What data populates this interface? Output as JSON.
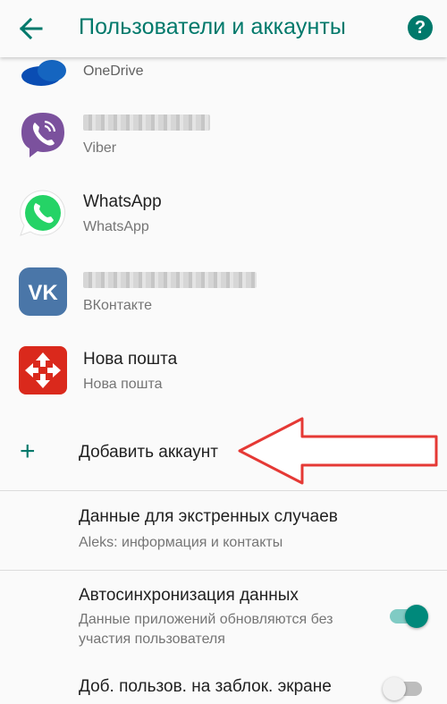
{
  "header": {
    "title": "Пользователи и аккаунты",
    "back_icon": "arrow-left-icon",
    "help_icon": "help-circle-icon",
    "help_glyph": "?"
  },
  "accounts": [
    {
      "name": "OneDrive",
      "sub": "OneDrive",
      "icon": "onedrive-icon",
      "color": "#0a4db3"
    },
    {
      "name": "",
      "sub": "Viber",
      "icon": "viber-icon",
      "color": "#7b519d"
    },
    {
      "name": "WhatsApp",
      "sub": "WhatsApp",
      "icon": "whatsapp-icon",
      "color": "#25d366"
    },
    {
      "name": "",
      "sub": "ВКонтакте",
      "icon": "vk-icon",
      "color": "#4a76a8"
    },
    {
      "name": "Нова пошта",
      "sub": "Нова пошта",
      "icon": "nova-poshta-icon",
      "color": "#da291c"
    }
  ],
  "add_account": {
    "label": "Добавить аккаунт",
    "icon": "plus-icon"
  },
  "emergency": {
    "title": "Данные для экстренных случаев",
    "sub": "Aleks: информация и контакты"
  },
  "autosync": {
    "title": "Автосинхронизация данных",
    "sub": "Данные приложений обновляются без участия пользователя",
    "enabled": true
  },
  "lockscreen_users": {
    "title": "Доб. пользов. на заблок. экране",
    "enabled": false
  },
  "colors": {
    "accent": "#00796b",
    "annotation": "#e53935"
  }
}
